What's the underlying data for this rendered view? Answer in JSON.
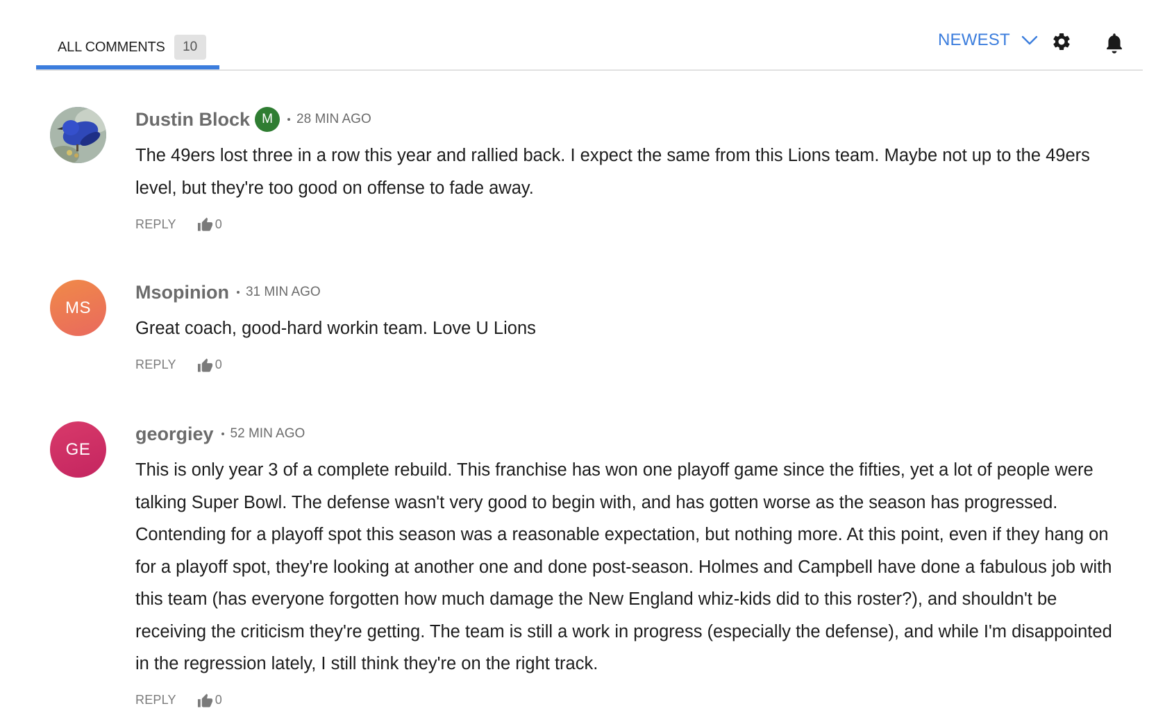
{
  "header": {
    "tab_label": "ALL COMMENTS",
    "tab_count": "10",
    "sort_label": "NEWEST",
    "accent_color": "#3b7ddd"
  },
  "comments": [
    {
      "author": "Dustin Block",
      "badge": "M",
      "time": "28 MIN AGO",
      "avatar_initials": "",
      "avatar_icon": "bird-photo",
      "text": "The 49ers lost three in a row this year and rallied back. I expect the same from this Lions team. Maybe not up to the 49ers level, but they're too good on offense to fade away.",
      "reply_label": "REPLY",
      "likes": "0"
    },
    {
      "author": "Msopinion",
      "time": "31 MIN AGO",
      "avatar_initials": "MS",
      "text": "Great coach, good-hard workin team. Love U Lions",
      "reply_label": "REPLY",
      "likes": "0"
    },
    {
      "author": "georgiey",
      "time": "52 MIN AGO",
      "avatar_initials": "GE",
      "text": "This is only year 3 of a complete rebuild. This franchise has won one playoff game since the fifties, yet a lot of people were talking Super Bowl. The defense wasn't very good to begin with, and has gotten worse as the season has progressed. Contending for a playoff spot this season was a reasonable expectation, but nothing more. At this point, even if they hang on for a playoff spot, they're looking at another one and done post-season. Holmes and Campbell have done a fabulous job with this team (has everyone forgotten how much damage the New England whiz-kids did to this roster?), and shouldn't be receiving the criticism they're getting. The team is still a work in progress (especially the defense), and while I'm disappointed in the regression lately, I still think they're on the right track.",
      "reply_label": "REPLY",
      "likes": "0"
    }
  ]
}
